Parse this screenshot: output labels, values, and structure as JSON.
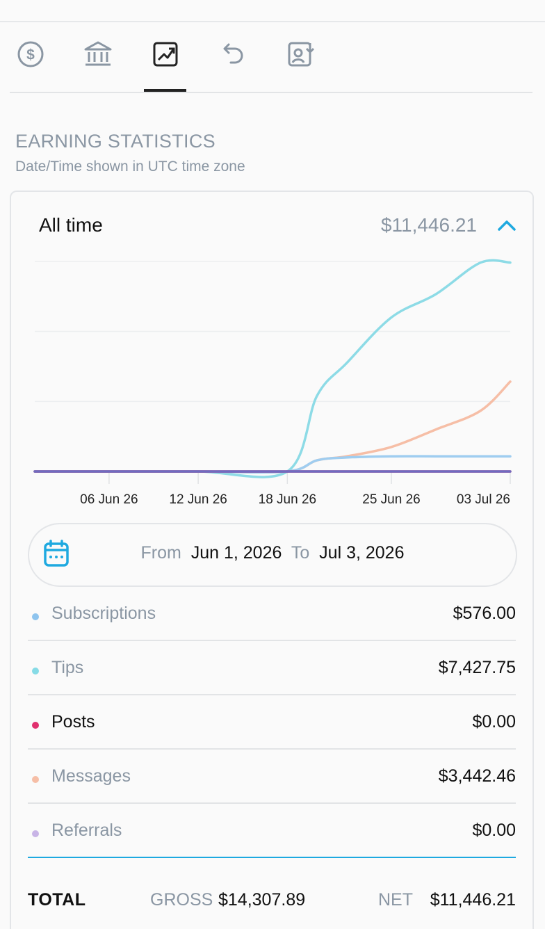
{
  "tabs": [
    {
      "name": "dollar-circle-icon",
      "active": false
    },
    {
      "name": "bank-icon",
      "active": false
    },
    {
      "name": "trending-chart-icon",
      "active": true
    },
    {
      "name": "undo-icon",
      "active": false
    },
    {
      "name": "statement-download-icon",
      "active": false
    }
  ],
  "section": {
    "title": "EARNING STATISTICS",
    "subtitle": "Date/Time shown in UTC time zone"
  },
  "summary": {
    "period_label": "All time",
    "period_total": "$11,446.21"
  },
  "chart_data": {
    "type": "line",
    "x_ticks": [
      "06 Jun 26",
      "12 Jun 26",
      "18 Jun 26",
      "25 Jun 26",
      "03 Jul 26"
    ],
    "x_dates": [
      "2026-06-01",
      "2026-06-06",
      "2026-06-12",
      "2026-06-18",
      "2026-06-20",
      "2026-06-22",
      "2026-06-25",
      "2026-06-28",
      "2026-07-01",
      "2026-07-03"
    ],
    "ylim": [
      0,
      9000
    ],
    "grid": true,
    "series": [
      {
        "name": "Tips",
        "color": "#8ddbe6",
        "values": [
          0,
          0,
          0,
          0,
          3250,
          4650,
          6600,
          7600,
          8950,
          8950
        ]
      },
      {
        "name": "Messages",
        "color": "#f6bea6",
        "values": [
          0,
          0,
          0,
          0,
          480,
          650,
          1050,
          1800,
          2600,
          3850
        ]
      },
      {
        "name": "Subscriptions",
        "color": "#9fcdf0",
        "values": [
          0,
          0,
          0,
          0,
          480,
          600,
          650,
          650,
          650,
          650
        ]
      },
      {
        "name": "Posts",
        "color": "#e0306e",
        "values": [
          0,
          0,
          0,
          0,
          0,
          0,
          0,
          0,
          0,
          0
        ]
      },
      {
        "name": "Referrals",
        "color": "#6f6cc0",
        "values": [
          0,
          0,
          0,
          0,
          0,
          0,
          0,
          0,
          0,
          0
        ]
      }
    ]
  },
  "date_range": {
    "from_label": "From",
    "from_value": "Jun 1, 2026",
    "to_label": "To",
    "to_value": "Jul 3, 2026"
  },
  "breakdown": [
    {
      "label": "Subscriptions",
      "amount": "$576.00",
      "color": "#8ec4ee",
      "active": false
    },
    {
      "label": "Tips",
      "amount": "$7,427.75",
      "color": "#86dbe6",
      "active": false
    },
    {
      "label": "Posts",
      "amount": "$0.00",
      "color": "#e0306e",
      "active": true
    },
    {
      "label": "Messages",
      "amount": "$3,442.46",
      "color": "#f6bea6",
      "active": false
    },
    {
      "label": "Referrals",
      "amount": "$0.00",
      "color": "#c8b4e6",
      "active": false
    }
  ],
  "total": {
    "label": "TOTAL",
    "gross_label": "GROSS",
    "gross_value": "$14,307.89",
    "net_label": "NET",
    "net_value": "$11,446.21"
  }
}
